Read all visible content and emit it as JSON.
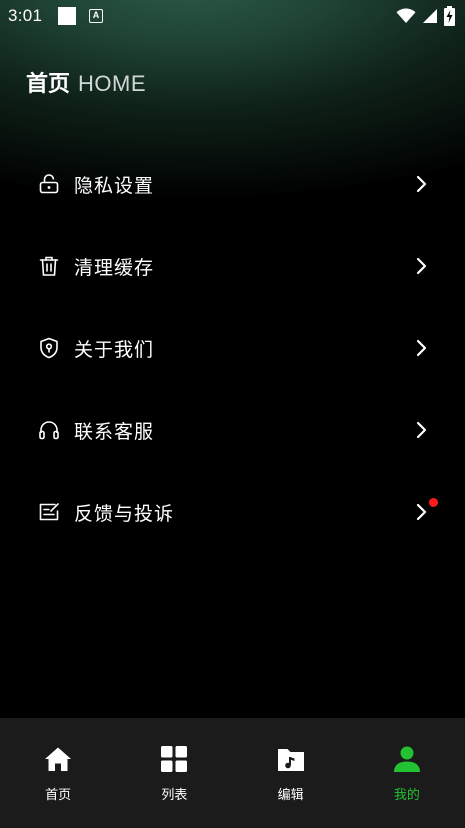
{
  "status_bar": {
    "time": "3:01",
    "a_icon_label": "A"
  },
  "header": {
    "title_cn": "首页",
    "title_en": "HOME"
  },
  "menu": {
    "items": [
      {
        "label": "隐私设置",
        "icon": "unlock-icon"
      },
      {
        "label": "清理缓存",
        "icon": "trash-icon"
      },
      {
        "label": "关于我们",
        "icon": "shield-icon"
      },
      {
        "label": "联系客服",
        "icon": "headset-icon"
      },
      {
        "label": "反馈与投诉",
        "icon": "feedback-icon",
        "has_notification_dot": true
      }
    ]
  },
  "tab_bar": {
    "active_color": "#22c232",
    "tabs": [
      {
        "label": "首页",
        "icon": "home-icon",
        "active": false
      },
      {
        "label": "列表",
        "icon": "grid-icon",
        "active": false
      },
      {
        "label": "编辑",
        "icon": "music-folder-icon",
        "active": false
      },
      {
        "label": "我的",
        "icon": "person-icon",
        "active": true
      }
    ]
  },
  "colors": {
    "background": "#000000",
    "tab_bar_bg": "#1b1b1b",
    "notification_dot": "#ff1a1a",
    "header_glow": "#2c5a48"
  }
}
